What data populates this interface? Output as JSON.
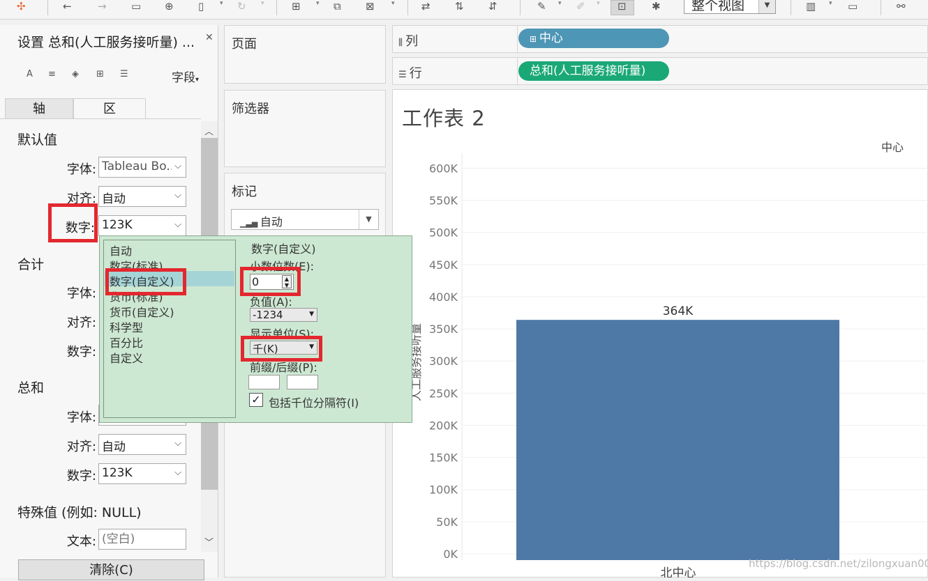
{
  "toolbar": {
    "view_mode": "整个视图",
    "icons": [
      "tableau-logo-icon",
      "undo-icon",
      "redo-icon",
      "save-icon",
      "new-datasource-icon",
      "new-worksheet-icon",
      "refresh-icon",
      "new-dashboard-icon",
      "duplicate-sheet-icon",
      "clear-sheet-icon",
      "swap-rows-columns-icon",
      "sort-ascending-icon",
      "sort-descending-icon",
      "highlight-icon",
      "annotate-icon",
      "fix-axes-icon",
      "pin-icon",
      "show-me-icon",
      "presentation-mode-icon",
      "share-icon"
    ]
  },
  "format_panel": {
    "title": "设置 总和(人工服务接听量) ...",
    "fields_label": "字段",
    "tabs": [
      {
        "label": "轴"
      },
      {
        "label": "区"
      }
    ],
    "active_tab": "区",
    "defaults": {
      "header": "默认值",
      "font_label": "字体:",
      "font_value": "Tableau Bo..",
      "align_label": "对齐:",
      "align_value": "自动",
      "number_label": "数字:",
      "number_value": "123K"
    },
    "totals": {
      "header": "合计",
      "font_label": "字体:",
      "align_label": "对齐:",
      "number_label": "数字:"
    },
    "grand_total": {
      "header": "总和",
      "font_label": "字体:",
      "align_label": "对齐:",
      "align_value": "自动",
      "number_label": "数字:",
      "number_value": "123K"
    },
    "special": {
      "header": "特殊值 (例如: NULL)",
      "text_label": "文本:",
      "text_placeholder": "(空白)"
    },
    "clear_button": "清除(C)"
  },
  "number_popup": {
    "formats": [
      "自动",
      "数字(标准)",
      "数字(自定义)",
      "货币(标准)",
      "货币(自定义)",
      "科学型",
      "百分比",
      "自定义"
    ],
    "selected": "数字(自定义)",
    "heading": "数字(自定义)",
    "decimals_label": "小数位数(E):",
    "decimals_value": "0",
    "negative_label": "负值(A):",
    "negative_value": "-1234",
    "units_label": "显示单位(S):",
    "units_value": "千(K)",
    "prefix_suffix_label": "前缀/后缀(P):",
    "thousands_label": "包括千位分隔符(I)",
    "thousands_checked": true
  },
  "cards": {
    "pages": "页面",
    "filters": "筛选器",
    "marks": "标记",
    "marks_type": "自动"
  },
  "shelves": {
    "columns_label": "列",
    "columns_pill": "中心",
    "rows_label": "行",
    "rows_pill": "总和(人工服务接听量)"
  },
  "worksheet": {
    "title": "工作表 2",
    "column_header": "中心",
    "watermark": "https://blog.csdn.net/zilongxuan008"
  },
  "colors": {
    "bar": "#4e79a7",
    "pill_dimension": "#4e96b5",
    "pill_measure": "#1aa877",
    "highlight": "#e3272e",
    "popup_bg": "#cde8d2"
  },
  "chart_data": {
    "type": "bar",
    "categories": [
      "北中心"
    ],
    "values": [
      364000
    ],
    "data_labels": [
      "364K"
    ],
    "ylabel": "人工服务接听量",
    "ylim": [
      0,
      620000
    ],
    "yticks": [
      0,
      50000,
      100000,
      150000,
      200000,
      250000,
      300000,
      350000,
      400000,
      450000,
      500000,
      550000,
      600000
    ],
    "ytick_labels": [
      "0K",
      "50K",
      "100K",
      "150K",
      "200K",
      "250K",
      "300K",
      "350K",
      "400K",
      "450K",
      "500K",
      "550K",
      "600K"
    ],
    "grid": true
  }
}
